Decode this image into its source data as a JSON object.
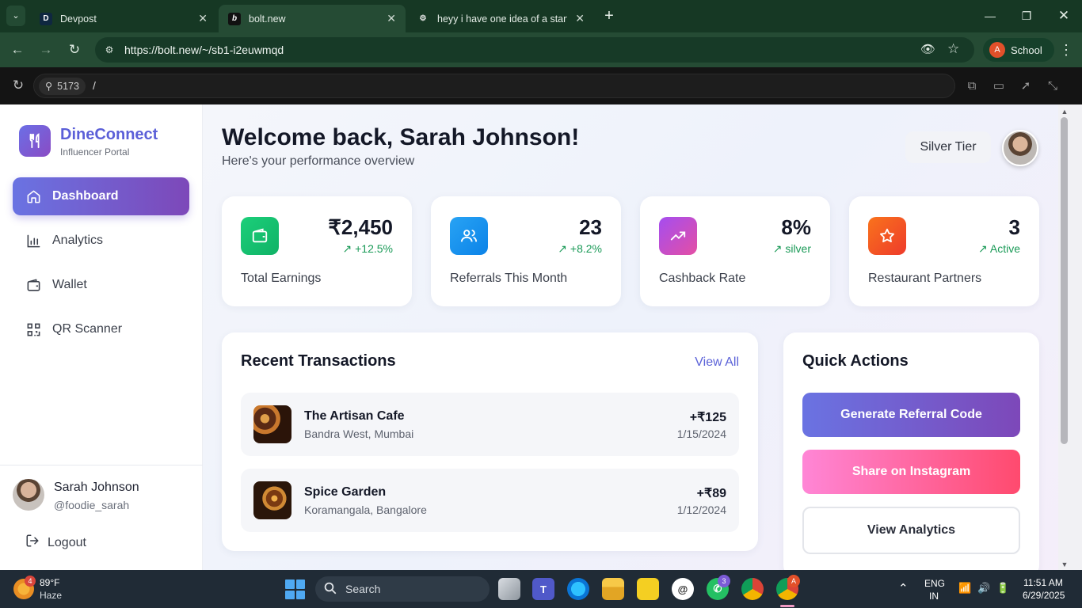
{
  "browser": {
    "tabs": [
      {
        "favicon": "D",
        "title": "Devpost"
      },
      {
        "favicon": "b",
        "title": "bolt.new"
      },
      {
        "favicon": "⚙",
        "title": "heyy i have one idea of a startu"
      }
    ],
    "url": "https://bolt.new/~/sb1-i2euwmqd",
    "profile_initial": "A",
    "profile_label": "School"
  },
  "preview": {
    "port": "5173",
    "path": "/"
  },
  "sidebar": {
    "brand_name": "DineConnect",
    "brand_sub": "Influencer Portal",
    "items": [
      {
        "label": "Dashboard",
        "icon": "home-icon"
      },
      {
        "label": "Analytics",
        "icon": "bar-chart-icon"
      },
      {
        "label": "Wallet",
        "icon": "wallet-icon"
      },
      {
        "label": "QR Scanner",
        "icon": "qr-icon"
      }
    ],
    "user_name": "Sarah Johnson",
    "user_handle": "@foodie_sarah",
    "logout_label": "Logout"
  },
  "header": {
    "welcome": "Welcome back, Sarah Johnson!",
    "subtitle": "Here's your performance overview",
    "tier": "Silver Tier"
  },
  "stats": [
    {
      "value": "₹2,450",
      "change": "+12.5%",
      "label": "Total Earnings",
      "icon": "wallet-icon"
    },
    {
      "value": "23",
      "change": "+8.2%",
      "label": "Referrals This Month",
      "icon": "users-icon"
    },
    {
      "value": "8%",
      "change": "silver",
      "label": "Cashback Rate",
      "icon": "trending-up-icon"
    },
    {
      "value": "3",
      "change": "Active",
      "label": "Restaurant Partners",
      "icon": "star-icon"
    }
  ],
  "transactions": {
    "title": "Recent Transactions",
    "view_all": "View All",
    "items": [
      {
        "name": "The Artisan Cafe",
        "location": "Bandra West, Mumbai",
        "amount": "+₹125",
        "date": "1/15/2024"
      },
      {
        "name": "Spice Garden",
        "location": "Koramangala, Bangalore",
        "amount": "+₹89",
        "date": "1/12/2024"
      }
    ]
  },
  "quick_actions": {
    "title": "Quick Actions",
    "buttons": [
      "Generate Referral Code",
      "Share on Instagram",
      "View Analytics"
    ]
  },
  "taskbar": {
    "temp": "89°F",
    "condition": "Haze",
    "weather_badge": "4",
    "search": "Search",
    "whatsapp_badge": "3",
    "lang_top": "ENG",
    "lang_bottom": "IN",
    "time": "11:51 AM",
    "date": "6/29/2025"
  },
  "colors": {
    "accent": "#5b5fd8",
    "positive": "#1a9a57",
    "brand_gradient_start": "#6a73e2",
    "brand_gradient_end": "#7d48b9"
  }
}
